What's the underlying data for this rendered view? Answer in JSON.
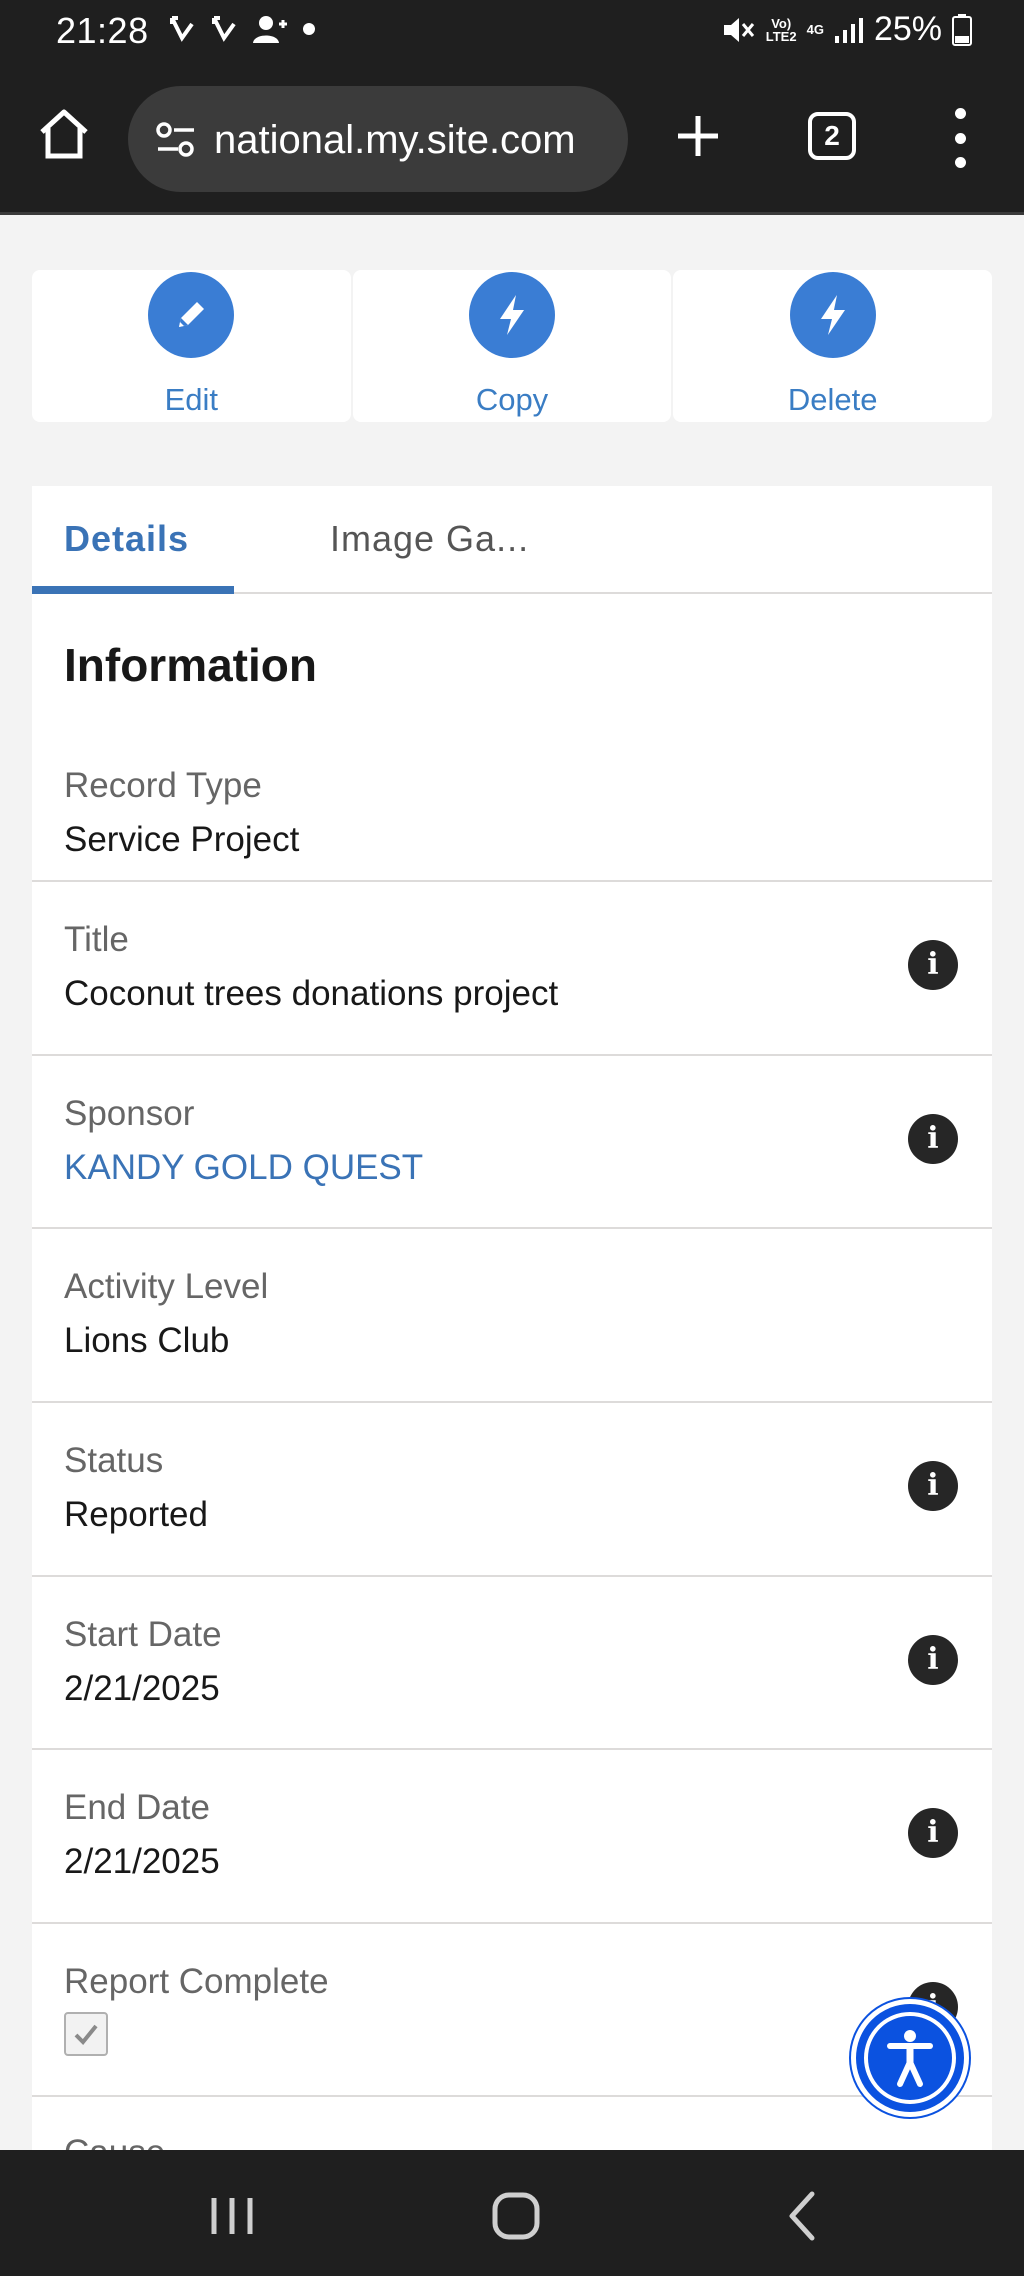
{
  "status_bar": {
    "time": "21:28",
    "network_top": "Vo)",
    "network_bottom": "LTE2",
    "network_gen": "4G",
    "battery": "25%",
    "icons": [
      "missed-call-icon",
      "missed-call-icon",
      "person-add-icon",
      "dot-icon",
      "mute-icon",
      "signal-icon",
      "battery-icon"
    ]
  },
  "browser": {
    "url": "national.my.site.com",
    "tab_count": "2",
    "icons": [
      "home-icon",
      "site-settings-icon",
      "new-tab-icon",
      "tab-switcher-icon",
      "more-menu-icon"
    ]
  },
  "actions": [
    {
      "label": "Edit",
      "icon": "pencil-icon"
    },
    {
      "label": "Copy",
      "icon": "lightning-icon"
    },
    {
      "label": "Delete",
      "icon": "lightning-icon"
    }
  ],
  "tabs": [
    {
      "label": "Details",
      "active": true
    },
    {
      "label": "Image Ga..."
    }
  ],
  "section_title": "Information",
  "fields": [
    {
      "label": "Record Type",
      "value": "Service Project",
      "info": false
    },
    {
      "label": "Title",
      "value": "Coconut trees donations project",
      "info": true
    },
    {
      "label": "Sponsor",
      "value": "KANDY GOLD QUEST",
      "info": true,
      "link": true
    },
    {
      "label": "Activity Level",
      "value": "Lions Club",
      "info": false
    },
    {
      "label": "Status",
      "value": "Reported",
      "info": true
    },
    {
      "label": "Start Date",
      "value": "2/21/2025",
      "info": true
    },
    {
      "label": "End Date",
      "value": "2/21/2025",
      "info": true
    },
    {
      "label": "Report Complete",
      "checked": true,
      "info": true
    },
    {
      "label": "Cause"
    }
  ],
  "info_glyph": "i",
  "colors": {
    "accent": "#3a73b6",
    "action_circle": "#3a7dd4",
    "accessibility": "#0b52e0"
  },
  "system_nav": [
    "recent-apps-icon",
    "home-icon",
    "back-icon"
  ]
}
